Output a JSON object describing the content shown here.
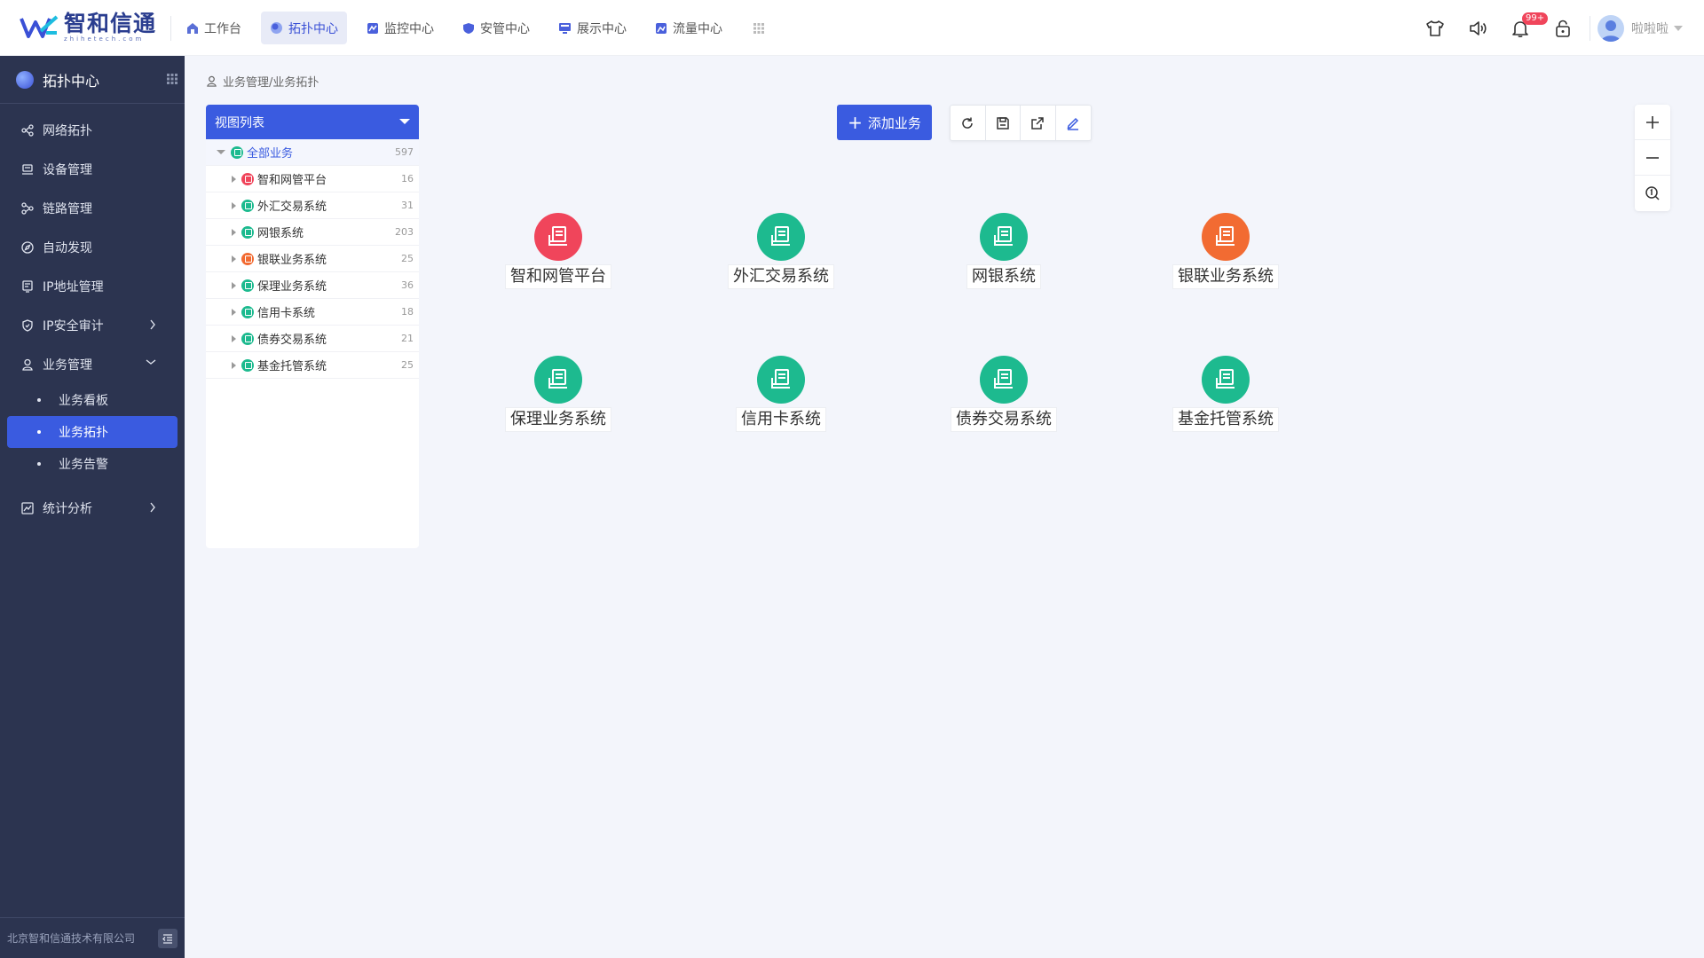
{
  "logo": {
    "name": "智和信通",
    "sub": "zhihetech.com"
  },
  "nav": [
    {
      "label": "工作台",
      "active": false
    },
    {
      "label": "拓扑中心",
      "active": true
    },
    {
      "label": "监控中心",
      "active": false
    },
    {
      "label": "安管中心",
      "active": false
    },
    {
      "label": "展示中心",
      "active": false
    },
    {
      "label": "流量中心",
      "active": false
    }
  ],
  "header": {
    "badge": "99+",
    "username": "啦啦啦"
  },
  "sidebar": {
    "title": "拓扑中心",
    "items": [
      {
        "label": "网络拓扑"
      },
      {
        "label": "设备管理"
      },
      {
        "label": "链路管理"
      },
      {
        "label": "自动发现"
      },
      {
        "label": "IP地址管理"
      },
      {
        "label": "IP安全审计"
      },
      {
        "label": "业务管理"
      },
      {
        "label": "统计分析"
      }
    ],
    "subitems": [
      {
        "label": "业务看板"
      },
      {
        "label": "业务拓扑"
      },
      {
        "label": "业务告警"
      }
    ],
    "footer": "北京智和信通技术有限公司"
  },
  "breadcrumb": "业务管理/业务拓扑",
  "tree": {
    "header": "视图列表",
    "root": {
      "label": "全部业务",
      "count": "597"
    },
    "rows": [
      {
        "label": "智和网管平台",
        "count": "16",
        "color": "#f0455b"
      },
      {
        "label": "外汇交易系统",
        "count": "31",
        "color": "#1dba8f"
      },
      {
        "label": "网银系统",
        "count": "203",
        "color": "#1dba8f"
      },
      {
        "label": "银联业务系统",
        "count": "25",
        "color": "#f26b32"
      },
      {
        "label": "保理业务系统",
        "count": "36",
        "color": "#1dba8f"
      },
      {
        "label": "信用卡系统",
        "count": "18",
        "color": "#1dba8f"
      },
      {
        "label": "债券交易系统",
        "count": "21",
        "color": "#1dba8f"
      },
      {
        "label": "基金托管系统",
        "count": "25",
        "color": "#1dba8f"
      }
    ]
  },
  "toolbar": {
    "add_label": "添加业务"
  },
  "nodes": [
    {
      "label": "智和网管平台",
      "color": "#f0455b"
    },
    {
      "label": "外汇交易系统",
      "color": "#1dba8f"
    },
    {
      "label": "网银系统",
      "color": "#1dba8f"
    },
    {
      "label": "银联业务系统",
      "color": "#f26b32"
    },
    {
      "label": "保理业务系统",
      "color": "#1dba8f"
    },
    {
      "label": "信用卡系统",
      "color": "#1dba8f"
    },
    {
      "label": "债券交易系统",
      "color": "#1dba8f"
    },
    {
      "label": "基金托管系统",
      "color": "#1dba8f"
    }
  ],
  "colors": {
    "accent": "#3a5be0",
    "sidebar": "#2c3450",
    "critical": "#f0455b",
    "warning": "#f26b32",
    "normal": "#1dba8f"
  }
}
